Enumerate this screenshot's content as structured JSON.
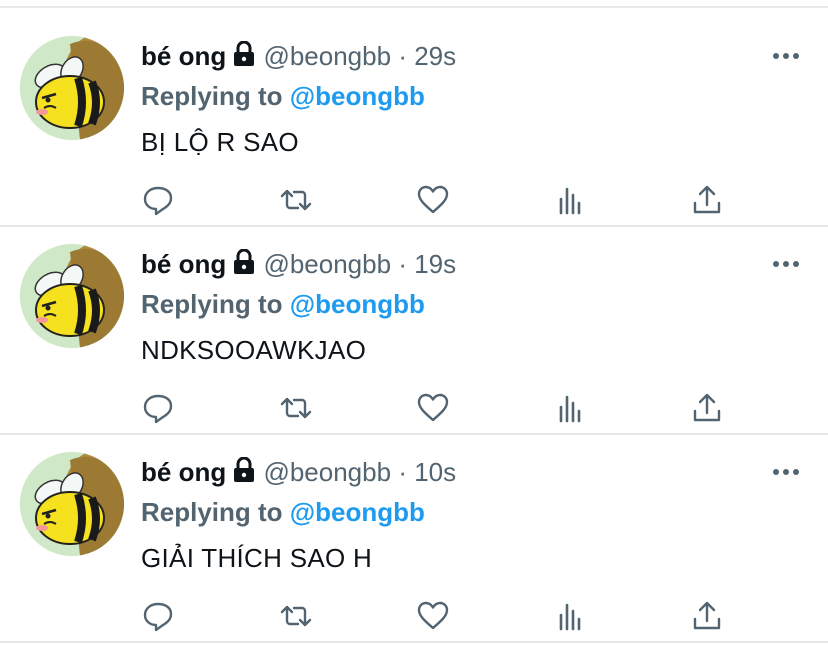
{
  "tweets": [
    {
      "name": "bé ong",
      "handle": "@beongbb",
      "separator": "·",
      "time": "29s",
      "replying_prefix": "Replying to",
      "replying_to": "@beongbb",
      "text": "BỊ LỘ R SAO"
    },
    {
      "name": "bé ong",
      "handle": "@beongbb",
      "separator": "·",
      "time": "19s",
      "replying_prefix": "Replying to",
      "replying_to": "@beongbb",
      "text": "NDKSOOAWKJAO"
    },
    {
      "name": "bé ong",
      "handle": "@beongbb",
      "separator": "·",
      "time": "10s",
      "replying_prefix": "Replying to",
      "replying_to": "@beongbb",
      "text": "GIẢI THÍCH SAO H"
    }
  ],
  "icons": {
    "lock": "lock-icon",
    "more": "more-icon",
    "reply": "reply-icon",
    "retweet": "retweet-icon",
    "like": "heart-icon",
    "views": "analytics-icon",
    "share": "share-icon"
  },
  "colors": {
    "accent": "#1d9bf0",
    "secondary_text": "#536471",
    "primary_text": "#0f1419",
    "divider": "#e6e8ea"
  }
}
